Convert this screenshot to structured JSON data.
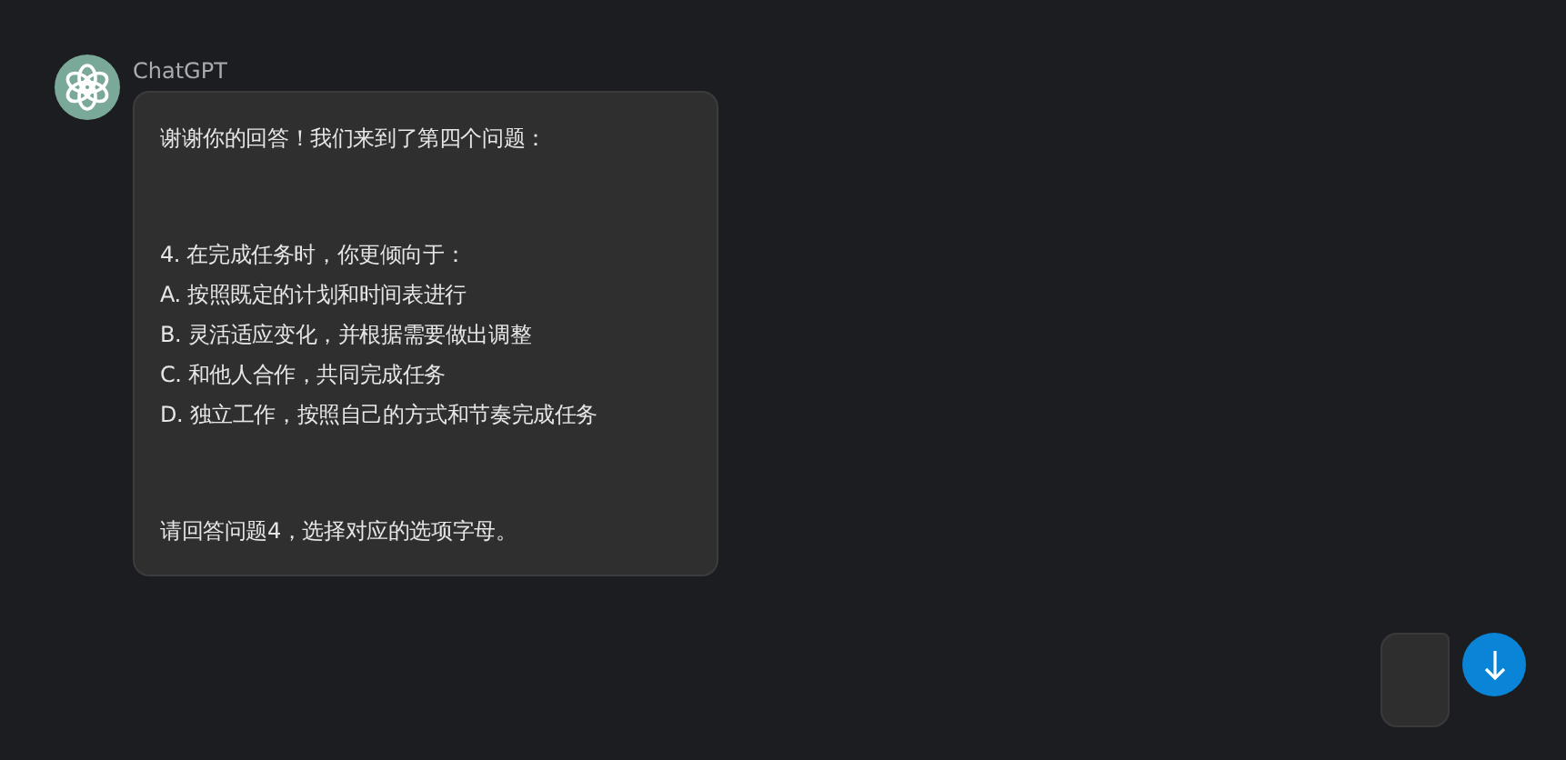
{
  "message": {
    "author": "ChatGPT",
    "paragraphs": [
      [
        "谢谢你的回答！我们来到了第四个问题："
      ],
      [
        "4. 在完成任务时，你更倾向于：",
        "A. 按照既定的计划和时间表进行",
        "B. 灵活适应变化，并根据需要做出调整",
        "C. 和他人合作，共同完成任务",
        "D. 独立工作，按照自己的方式和节奏完成任务"
      ],
      [
        "请回答问题4，选择对应的选项字母。"
      ]
    ]
  }
}
